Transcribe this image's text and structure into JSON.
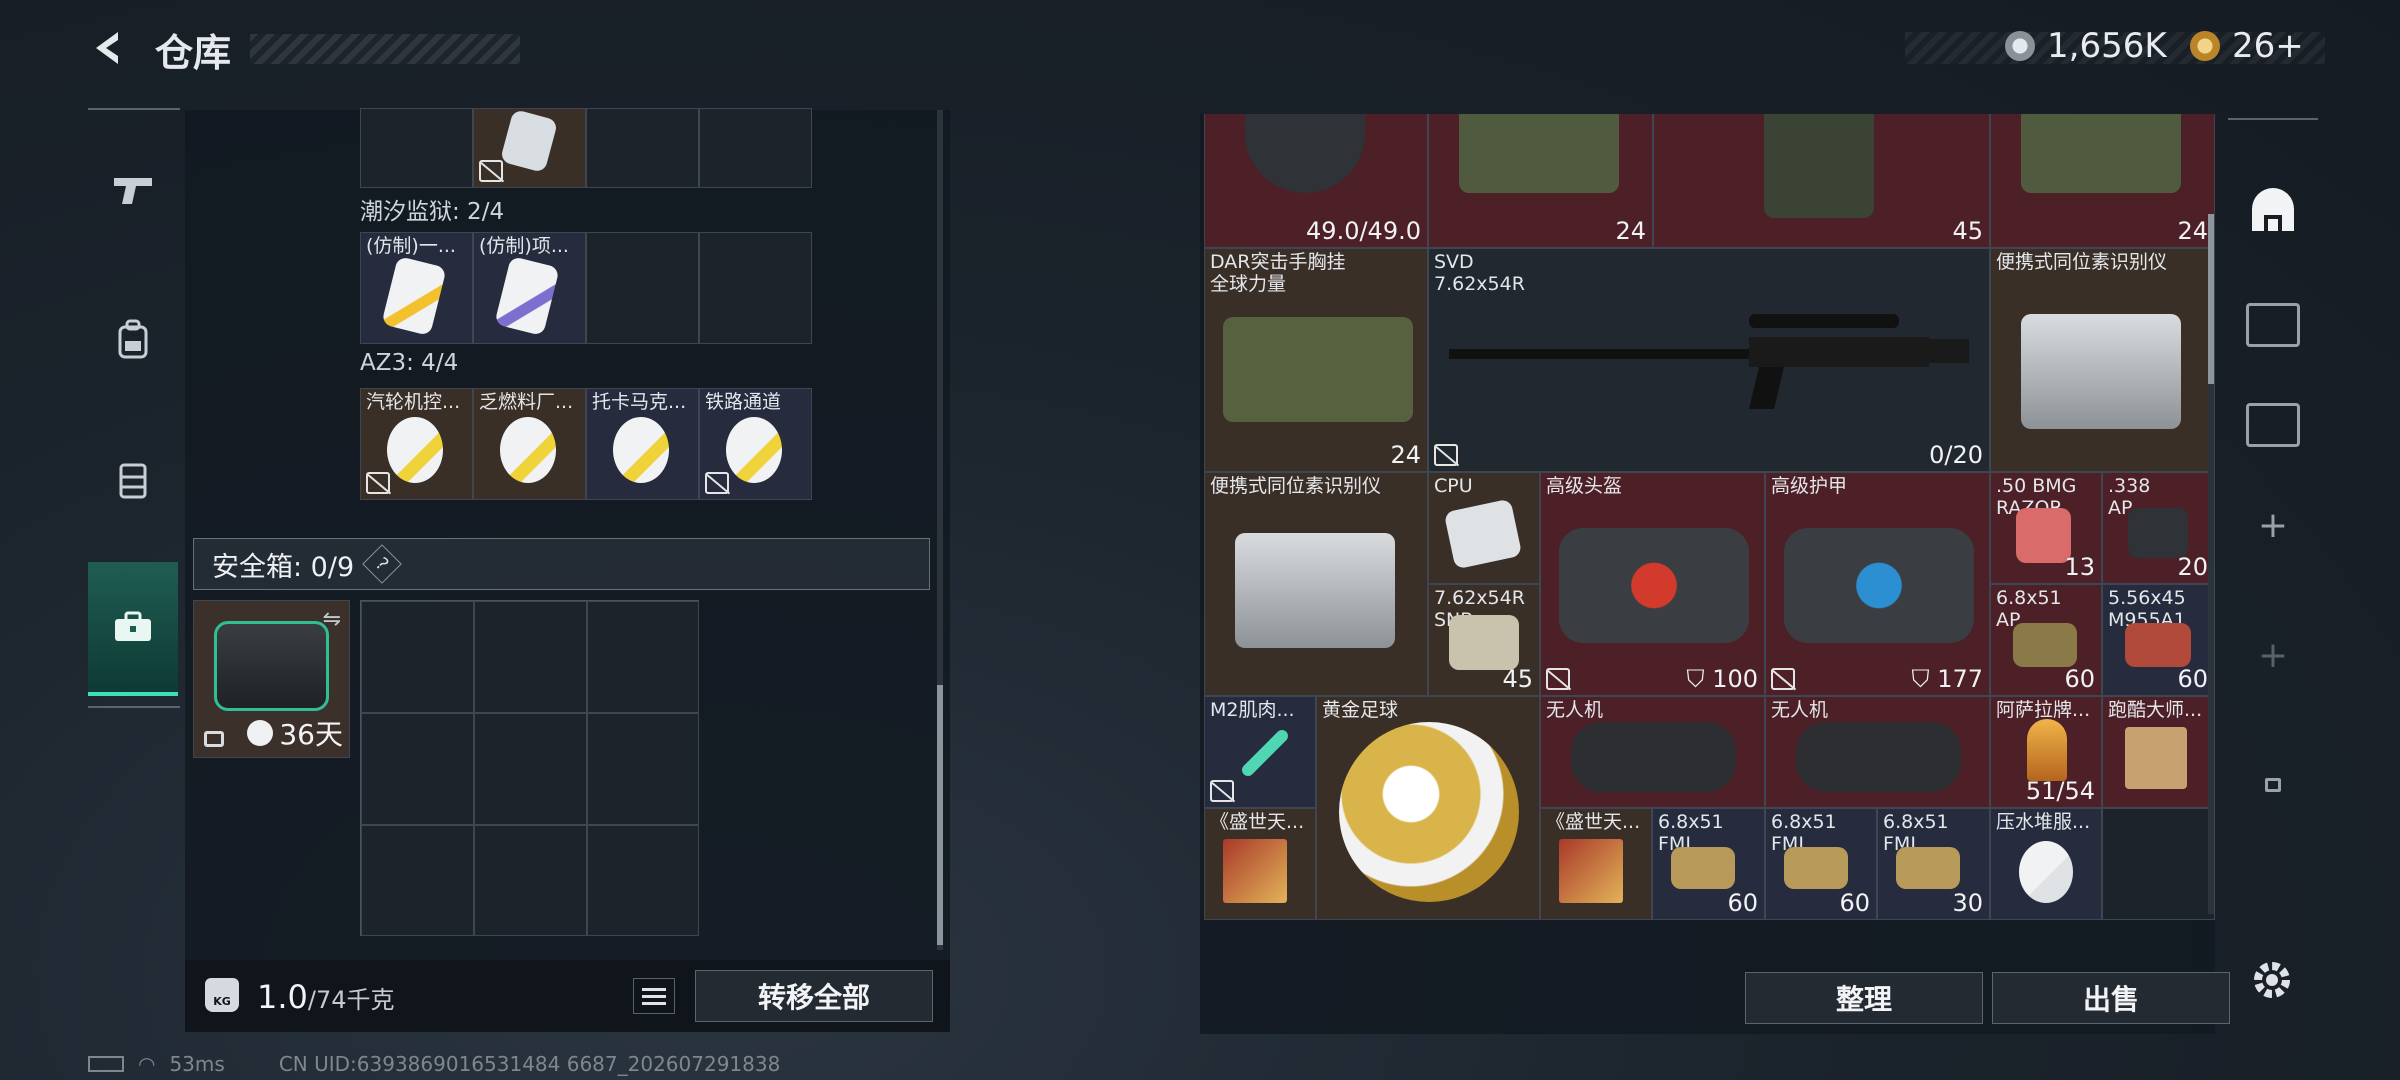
{
  "header": {
    "title": "仓库",
    "silver_value": "1,656K",
    "gold_value": "26+"
  },
  "left_sidebar": {
    "tabs": [
      "weapon-tab",
      "backpack-tab",
      "container-tab",
      "safebox-tab"
    ],
    "active": "safebox-tab"
  },
  "left_panel": {
    "group1": {
      "label": "潮汐监狱: 2/4",
      "items": [
        "(仿制)一...",
        "(仿制)项..."
      ]
    },
    "group2": {
      "label": "AZ3: 4/4",
      "items": [
        "汽轮机控...",
        "乏燃料厂...",
        "托卡马克...",
        "铁路通道"
      ]
    },
    "safebox": {
      "label": "安全箱: 0/9",
      "help": "?",
      "days": "36天"
    },
    "weight_value": "1.0",
    "weight_max": "/74千克",
    "transfer_all": "转移全部"
  },
  "right_panel": {
    "row_top": {
      "helmet_durability": "49.0/49.0",
      "c1": "24",
      "c2": "45",
      "c3": "24"
    },
    "items": {
      "chest_rig": {
        "name": "DAR突击手胸挂\n全球力量",
        "count": "24"
      },
      "svd": {
        "name": "SVD\n7.62x54R",
        "ammo": "0/20"
      },
      "isotope1": {
        "name": "便携式同位素识别仪"
      },
      "isotope2": {
        "name": "便携式同位素识别仪"
      },
      "cpu": {
        "name": "CPU"
      },
      "ammo_762": {
        "name": "7.62x54R\nSNB",
        "count": "45"
      },
      "helmet_case": {
        "name": "高级头盔",
        "value": "100"
      },
      "armor_case": {
        "name": "高级护甲",
        "value": "177"
      },
      "bmg": {
        "name": ".50 BMG\nRAZOR",
        "count": "13"
      },
      "ap338": {
        "name": ".338\nAP",
        "count": "20"
      },
      "ap68": {
        "name": "6.8x51\nAP",
        "count": "60"
      },
      "m855": {
        "name": "5.56x45\nM955A1",
        "count": "60"
      },
      "m2": {
        "name": "M2肌肉..."
      },
      "football": {
        "name": "黄金足球"
      },
      "drone1": {
        "name": "无人机"
      },
      "drone2": {
        "name": "无人机"
      },
      "asala": {
        "name": "阿萨拉牌...",
        "count": "51/54"
      },
      "parkour": {
        "name": "跑酷大师..."
      },
      "shengshi1": {
        "name": "《盛世天..."
      },
      "shengshi2": {
        "name": "《盛世天..."
      },
      "fmj1": {
        "name": "6.8x51\nFMJ",
        "count": "60"
      },
      "fmj2": {
        "name": "6.8x51\nFMJ",
        "count": "60"
      },
      "fmj3": {
        "name": "6.8x51\nFMJ",
        "count": "30"
      },
      "compress": {
        "name": "压水堆服..."
      }
    },
    "sort": "整理",
    "sell": "出售"
  },
  "status": {
    "ping": "53ms",
    "uid": "CN UID:6393869016531484 6687_202607291838"
  }
}
